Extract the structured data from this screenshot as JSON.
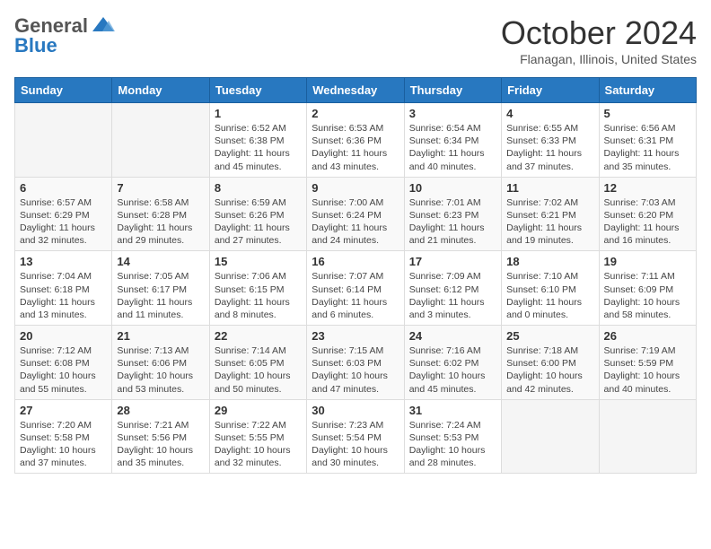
{
  "header": {
    "logo_line1": "General",
    "logo_line2": "Blue",
    "month": "October 2024",
    "location": "Flanagan, Illinois, United States"
  },
  "days_of_week": [
    "Sunday",
    "Monday",
    "Tuesday",
    "Wednesday",
    "Thursday",
    "Friday",
    "Saturday"
  ],
  "weeks": [
    [
      {
        "num": "",
        "info": ""
      },
      {
        "num": "",
        "info": ""
      },
      {
        "num": "1",
        "info": "Sunrise: 6:52 AM\nSunset: 6:38 PM\nDaylight: 11 hours and 45 minutes."
      },
      {
        "num": "2",
        "info": "Sunrise: 6:53 AM\nSunset: 6:36 PM\nDaylight: 11 hours and 43 minutes."
      },
      {
        "num": "3",
        "info": "Sunrise: 6:54 AM\nSunset: 6:34 PM\nDaylight: 11 hours and 40 minutes."
      },
      {
        "num": "4",
        "info": "Sunrise: 6:55 AM\nSunset: 6:33 PM\nDaylight: 11 hours and 37 minutes."
      },
      {
        "num": "5",
        "info": "Sunrise: 6:56 AM\nSunset: 6:31 PM\nDaylight: 11 hours and 35 minutes."
      }
    ],
    [
      {
        "num": "6",
        "info": "Sunrise: 6:57 AM\nSunset: 6:29 PM\nDaylight: 11 hours and 32 minutes."
      },
      {
        "num": "7",
        "info": "Sunrise: 6:58 AM\nSunset: 6:28 PM\nDaylight: 11 hours and 29 minutes."
      },
      {
        "num": "8",
        "info": "Sunrise: 6:59 AM\nSunset: 6:26 PM\nDaylight: 11 hours and 27 minutes."
      },
      {
        "num": "9",
        "info": "Sunrise: 7:00 AM\nSunset: 6:24 PM\nDaylight: 11 hours and 24 minutes."
      },
      {
        "num": "10",
        "info": "Sunrise: 7:01 AM\nSunset: 6:23 PM\nDaylight: 11 hours and 21 minutes."
      },
      {
        "num": "11",
        "info": "Sunrise: 7:02 AM\nSunset: 6:21 PM\nDaylight: 11 hours and 19 minutes."
      },
      {
        "num": "12",
        "info": "Sunrise: 7:03 AM\nSunset: 6:20 PM\nDaylight: 11 hours and 16 minutes."
      }
    ],
    [
      {
        "num": "13",
        "info": "Sunrise: 7:04 AM\nSunset: 6:18 PM\nDaylight: 11 hours and 13 minutes."
      },
      {
        "num": "14",
        "info": "Sunrise: 7:05 AM\nSunset: 6:17 PM\nDaylight: 11 hours and 11 minutes."
      },
      {
        "num": "15",
        "info": "Sunrise: 7:06 AM\nSunset: 6:15 PM\nDaylight: 11 hours and 8 minutes."
      },
      {
        "num": "16",
        "info": "Sunrise: 7:07 AM\nSunset: 6:14 PM\nDaylight: 11 hours and 6 minutes."
      },
      {
        "num": "17",
        "info": "Sunrise: 7:09 AM\nSunset: 6:12 PM\nDaylight: 11 hours and 3 minutes."
      },
      {
        "num": "18",
        "info": "Sunrise: 7:10 AM\nSunset: 6:10 PM\nDaylight: 11 hours and 0 minutes."
      },
      {
        "num": "19",
        "info": "Sunrise: 7:11 AM\nSunset: 6:09 PM\nDaylight: 10 hours and 58 minutes."
      }
    ],
    [
      {
        "num": "20",
        "info": "Sunrise: 7:12 AM\nSunset: 6:08 PM\nDaylight: 10 hours and 55 minutes."
      },
      {
        "num": "21",
        "info": "Sunrise: 7:13 AM\nSunset: 6:06 PM\nDaylight: 10 hours and 53 minutes."
      },
      {
        "num": "22",
        "info": "Sunrise: 7:14 AM\nSunset: 6:05 PM\nDaylight: 10 hours and 50 minutes."
      },
      {
        "num": "23",
        "info": "Sunrise: 7:15 AM\nSunset: 6:03 PM\nDaylight: 10 hours and 47 minutes."
      },
      {
        "num": "24",
        "info": "Sunrise: 7:16 AM\nSunset: 6:02 PM\nDaylight: 10 hours and 45 minutes."
      },
      {
        "num": "25",
        "info": "Sunrise: 7:18 AM\nSunset: 6:00 PM\nDaylight: 10 hours and 42 minutes."
      },
      {
        "num": "26",
        "info": "Sunrise: 7:19 AM\nSunset: 5:59 PM\nDaylight: 10 hours and 40 minutes."
      }
    ],
    [
      {
        "num": "27",
        "info": "Sunrise: 7:20 AM\nSunset: 5:58 PM\nDaylight: 10 hours and 37 minutes."
      },
      {
        "num": "28",
        "info": "Sunrise: 7:21 AM\nSunset: 5:56 PM\nDaylight: 10 hours and 35 minutes."
      },
      {
        "num": "29",
        "info": "Sunrise: 7:22 AM\nSunset: 5:55 PM\nDaylight: 10 hours and 32 minutes."
      },
      {
        "num": "30",
        "info": "Sunrise: 7:23 AM\nSunset: 5:54 PM\nDaylight: 10 hours and 30 minutes."
      },
      {
        "num": "31",
        "info": "Sunrise: 7:24 AM\nSunset: 5:53 PM\nDaylight: 10 hours and 28 minutes."
      },
      {
        "num": "",
        "info": ""
      },
      {
        "num": "",
        "info": ""
      }
    ]
  ]
}
